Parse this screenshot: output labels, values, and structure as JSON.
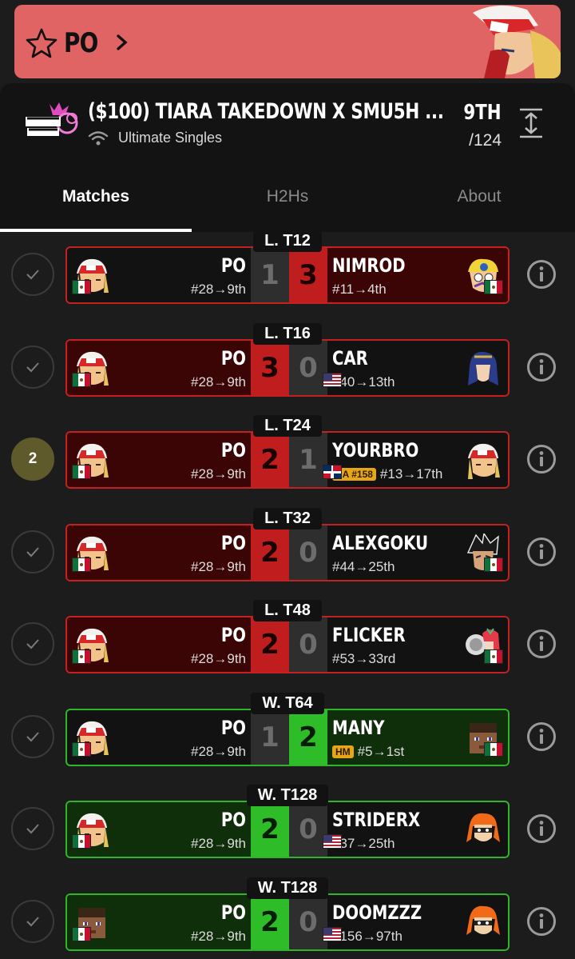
{
  "banner": {
    "player": "PO",
    "color": "#e06464"
  },
  "tournament": {
    "name": "($100) TIARA TAKEDOWN X SMU5H ...",
    "event": "Ultimate Singles",
    "placing": "9TH",
    "entrants": "/124"
  },
  "tabs": [
    "Matches",
    "H2Hs",
    "About"
  ],
  "matches": [
    {
      "round": "L. T12",
      "check": "",
      "left": {
        "name": "PO",
        "seed": "#28→9th",
        "flag": "mx",
        "char": "terry"
      },
      "s1": "1",
      "s2": "3",
      "right": {
        "name": "NIMROD",
        "seed": "#11→4th",
        "flag": "mx",
        "char": "wario",
        "tag": ""
      },
      "winner": "right"
    },
    {
      "round": "L. T16",
      "check": "",
      "left": {
        "name": "PO",
        "seed": "#28→9th",
        "flag": "mx",
        "char": "terry"
      },
      "s1": "3",
      "s2": "0",
      "right": {
        "name": "CAR",
        "seed": "#40→13th",
        "flag": "us",
        "char": "lucina",
        "tag": ""
      },
      "winner": "left-loss"
    },
    {
      "round": "L. T24",
      "check": "2",
      "left": {
        "name": "PO",
        "seed": "#28→9th",
        "flag": "mx",
        "char": "terry"
      },
      "s1": "2",
      "s2": "1",
      "right": {
        "name": "YOURBRO",
        "seed": "#13→17th",
        "flag": "do",
        "char": "terry",
        "tag": "NA #158"
      },
      "winner": "left-loss"
    },
    {
      "round": "L. T32",
      "check": "",
      "left": {
        "name": "PO",
        "seed": "#28→9th",
        "flag": "mx",
        "char": "terry"
      },
      "s1": "2",
      "s2": "0",
      "right": {
        "name": "ALEXGOKU",
        "seed": "#44→25th",
        "flag": "mx",
        "char": "kazuya",
        "tag": ""
      },
      "winner": "left-loss"
    },
    {
      "round": "L. T48",
      "check": "",
      "left": {
        "name": "PO",
        "seed": "#28→9th",
        "flag": "mx",
        "char": "terry"
      },
      "s1": "2",
      "s2": "0",
      "right": {
        "name": "FLICKER",
        "seed": "#53→33rd",
        "flag": "mx",
        "char": "pyra",
        "tag": ""
      },
      "winner": "left-loss"
    },
    {
      "round": "W. T64",
      "check": "",
      "left": {
        "name": "PO",
        "seed": "#28→9th",
        "flag": "mx",
        "char": "terry"
      },
      "s1": "1",
      "s2": "2",
      "right": {
        "name": "MANY",
        "seed": "#5→1st",
        "flag": "mx",
        "char": "steve",
        "tag": "HM"
      },
      "winner": "right-win"
    },
    {
      "round": "W. T128",
      "check": "",
      "left": {
        "name": "PO",
        "seed": "#28→9th",
        "flag": "mx",
        "char": "terry"
      },
      "s1": "2",
      "s2": "0",
      "right": {
        "name": "STRIDERX",
        "seed": "#37→25th",
        "flag": "us",
        "char": "inkling",
        "tag": ""
      },
      "winner": "left-win"
    },
    {
      "round": "W. T128",
      "check": "",
      "left": {
        "name": "PO",
        "seed": "#28→9th",
        "flag": "mx",
        "char": "steve"
      },
      "s1": "2",
      "s2": "0",
      "right": {
        "name": "DOOMZZZ",
        "seed": "#156→97th",
        "flag": "us",
        "char": "inkling",
        "tag": ""
      },
      "winner": "left-win"
    }
  ]
}
